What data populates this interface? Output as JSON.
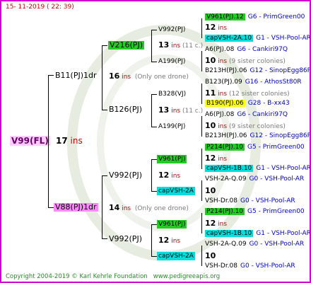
{
  "header": {
    "timestamp": "15- 11-2019 ( 22: 39)"
  },
  "footer": {
    "copyright": "Copyright 2004-2019 © Karl Kehrle Foundation",
    "url": "www.pedigreeapis.org"
  },
  "root": {
    "name": "V99(FL)",
    "gen": "17",
    "ins": "ins"
  },
  "colors": {
    "border": "#d000d0",
    "green": "#22cc22",
    "cyan": "#00dddd",
    "yellow": "#ffff00",
    "magenta": "#ff88ff"
  },
  "nodes": {
    "b11": {
      "name": "B11(PJ)1dr",
      "gen": "16",
      "ins": "ins",
      "note": "(Only one drone)"
    },
    "v88": {
      "name": "V88(PJ)1dr",
      "gen": "14",
      "ins": "ins",
      "note": "(Only one drone)"
    },
    "v216": {
      "name": "V216(PJ)"
    },
    "b126": {
      "name": "B126(PJ)"
    },
    "v992a": {
      "name": "V992(PJ)",
      "gen": "13",
      "ins": "ins",
      "note": "(11 c.)"
    },
    "a199a": {
      "name": "A199(PJ)"
    },
    "b328": {
      "name": "B328(VJ)",
      "gen": "13",
      "ins": "ins",
      "note": "(11 c.)"
    },
    "a199b": {
      "name": "A199(PJ)"
    },
    "v992b": {
      "name": "V992(PJ)",
      "gen": "12",
      "ins": "ins"
    },
    "v961a": {
      "name": "V961(PJ)"
    },
    "capa": {
      "name": "capVSH-2A"
    },
    "v992c": {
      "name": "V992(PJ)",
      "gen": "12",
      "ins": "ins"
    },
    "v961b": {
      "name": "V961(PJ)"
    },
    "capb": {
      "name": "capVSH-2A"
    }
  },
  "leaves": [
    {
      "name": "V961(PJ).12",
      "gcode": "G6",
      "breeder": "PrimGreen00"
    },
    {
      "gen": "12",
      "ins": "ins"
    },
    {
      "name": "capVSH-2A.10",
      "gcode": "G1",
      "breeder": "VSH-Pool-AR"
    },
    {
      "name": "A6(PJ).08",
      "gcode": "G6",
      "breeder": "Cankiri97Q"
    },
    {
      "gen": "10",
      "ins": "ins",
      "note": "(9 sister colonies)"
    },
    {
      "name": "B213H(PJ).06",
      "gcode": "G12",
      "breeder": "SinopEgg86R"
    },
    {
      "name": "B123(PJ).09",
      "gcode": "G16",
      "breeder": "AthosSt80R"
    },
    {
      "gen": "11",
      "ins": "ins",
      "note": "(12 sister colonies)"
    },
    {
      "name": "B190(PJ).06",
      "gcode": "G28",
      "breeder": "B-xx43"
    },
    {
      "name": "A6(PJ).08",
      "gcode": "G6",
      "breeder": "Cankiri97Q"
    },
    {
      "gen": "10",
      "ins": "ins",
      "note": "(9 sister colonies)"
    },
    {
      "name": "B213H(PJ).06",
      "gcode": "G12",
      "breeder": "SinopEgg86R"
    },
    {
      "name": "P214(PJ).10",
      "gcode": "G5",
      "breeder": "PrimGreen00"
    },
    {
      "gen": "12",
      "ins": "ins"
    },
    {
      "name": "capVSH-1B.10",
      "gcode": "G1",
      "breeder": "VSH-Pool-AR"
    },
    {
      "name": "VSH-2A-Q.09",
      "gcode": "G0",
      "breeder": "VSH-Pool-AR"
    },
    {
      "gen": "10"
    },
    {
      "name": "VSH-Dr.08",
      "gcode": "G0",
      "breeder": "VSH-Pool-AR"
    },
    {
      "name": "P214(PJ).10",
      "gcode": "G5",
      "breeder": "PrimGreen00"
    },
    {
      "gen": "12",
      "ins": "ins"
    },
    {
      "name": "capVSH-1B.10",
      "gcode": "G1",
      "breeder": "VSH-Pool-AR"
    },
    {
      "name": "VSH-2A-Q.09",
      "gcode": "G0",
      "breeder": "VSH-Pool-AR"
    },
    {
      "gen": "10"
    },
    {
      "name": "VSH-Dr.08",
      "gcode": "G0",
      "breeder": "VSH-Pool-AR"
    }
  ]
}
